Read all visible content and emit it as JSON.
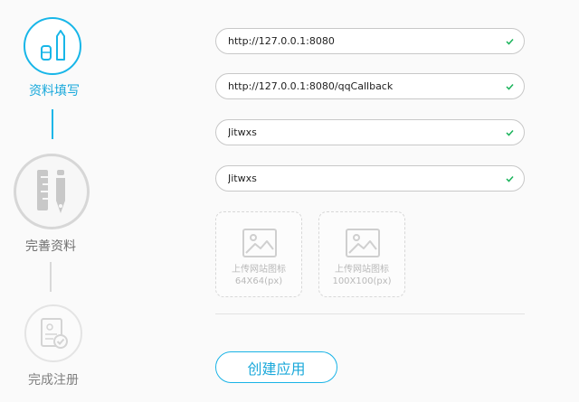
{
  "steps": [
    {
      "label": "资料填写",
      "icon": "edit-tools-icon",
      "state": "active"
    },
    {
      "label": "完善资料",
      "icon": "ruler-pen-icon",
      "state": "pending"
    },
    {
      "label": "完成注册",
      "icon": "document-check-icon",
      "state": "pending"
    }
  ],
  "fields": [
    {
      "value": "http://127.0.0.1:8080",
      "status_icon": "check-icon"
    },
    {
      "value": "http://127.0.0.1:8080/qqCallback",
      "status_icon": "check-icon"
    },
    {
      "value": "Jitwxs",
      "status_icon": "check-icon"
    },
    {
      "value": "Jitwxs",
      "status_icon": "check-icon"
    }
  ],
  "uploads": [
    {
      "label": "上传网站图标",
      "size": "64X64(px)",
      "icon": "image-placeholder-icon"
    },
    {
      "label": "上传网站图标",
      "size": "100X100(px)",
      "icon": "image-placeholder-icon"
    }
  ],
  "actions": {
    "create_label": "创建应用"
  },
  "colors": {
    "accent": "#18b6e8",
    "inactive": "#d7d7d7",
    "check": "#19b35a"
  }
}
